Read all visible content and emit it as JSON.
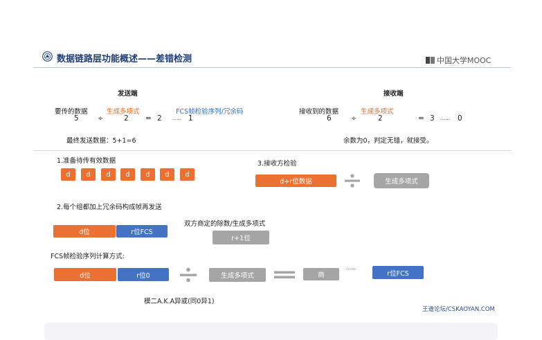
{
  "header": {
    "title": "数据链路层功能概述——差错检测",
    "brand": "中国大学MOOC",
    "footer": "王道论坛/CSKAOYAN.COM"
  },
  "sender": {
    "heading": "发送端",
    "data_label": "要传的数据",
    "gen_label": "生成多项式",
    "fcs_label": "FCS帧检验序列/冗余码",
    "data_val": "5",
    "div": "÷",
    "gen_val": "2",
    "eq": "=",
    "quot": "2",
    "dots": "……",
    "rem": "1",
    "final": "最终发送数据：5+1=6"
  },
  "receiver": {
    "heading": "接收端",
    "data_label": "接收到的数据",
    "gen_label": "生成多项式",
    "data_val": "6",
    "div": "÷",
    "gen_val": "2",
    "eq": "=",
    "quot": "3",
    "dots": "……",
    "rem": "0",
    "conclusion": "余数为0，判定无错，就接受。"
  },
  "step1": {
    "label": "1.准备待传有效数据",
    "boxes": [
      "d",
      "d",
      "d",
      "d",
      "d",
      "d",
      "d"
    ]
  },
  "step2": {
    "label": "2.每个组都加上冗余码构成帧再发送",
    "d_box": "d位",
    "r_box": "r位FCS",
    "agree": "双方商定的除数/生成多项式",
    "r1_box": "r+1位"
  },
  "step3": {
    "label": "3.接收方检验",
    "dr_box": "d+r位数据",
    "gen_box": "生成多项式"
  },
  "fcs_calc": {
    "label": "FCS帧检验序列计算方式:",
    "d_box": "d位",
    "r0_box": "r位0",
    "gen_box": "生成多项式",
    "quot_box": "商",
    "dots": "……",
    "fcs_box": "r位FCS",
    "note": "模二A.K.A异或(同0异1)"
  },
  "icons": {
    "logo": "university-seal-icon",
    "brand": "mooc-logo-icon",
    "divide": "divide-icon",
    "equals": "equals-icon"
  },
  "colors": {
    "orange": "#ec7031",
    "blue": "#4472c4",
    "gray": "#a5a5a5",
    "title": "#1f3e78"
  }
}
